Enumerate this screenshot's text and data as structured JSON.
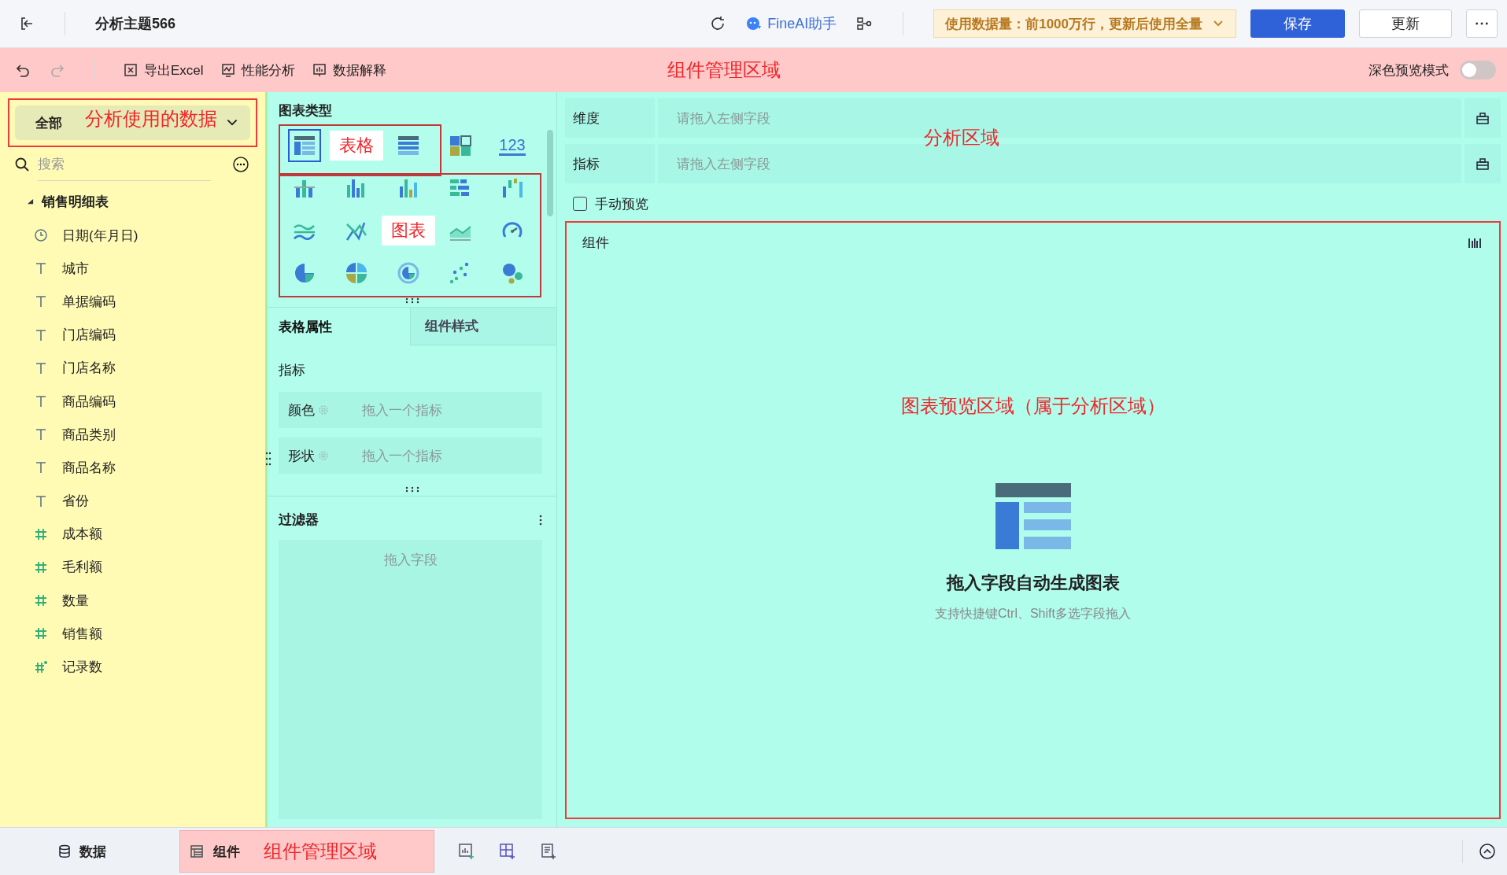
{
  "header": {
    "title": "分析主题566",
    "assistant": "FineAI助手",
    "data_notice": "使用数据量：前1000万行，更新后使用全量",
    "save": "保存",
    "update": "更新"
  },
  "toolbar": {
    "items": [
      {
        "kind": "excel",
        "label": "导出Excel"
      },
      {
        "kind": "performance",
        "label": "性能分析"
      },
      {
        "kind": "explain",
        "label": "数据解释"
      }
    ],
    "annotation": "组件管理区域",
    "dark_mode": {
      "label": "深色预览模式",
      "on": false
    }
  },
  "data_panel": {
    "source": "全部",
    "annotation": "分析使用的数据",
    "search": {
      "placeholder": "搜索"
    },
    "tree": [
      {
        "label": "销售明细表",
        "expanded": true,
        "children": [
          {
            "label": "日期(年月日)",
            "kind": "date"
          },
          {
            "label": "城市",
            "kind": "text"
          },
          {
            "label": "单据编码",
            "kind": "text"
          },
          {
            "label": "门店编码",
            "kind": "text"
          },
          {
            "label": "门店名称",
            "kind": "text"
          },
          {
            "label": "商品编码",
            "kind": "text"
          },
          {
            "label": "商品类别",
            "kind": "text"
          },
          {
            "label": "商品名称",
            "kind": "text"
          },
          {
            "label": "省份",
            "kind": "text"
          },
          {
            "label": "成本额",
            "kind": "number"
          },
          {
            "label": "毛利额",
            "kind": "number"
          },
          {
            "label": "数量",
            "kind": "number"
          },
          {
            "label": "销售额",
            "kind": "number"
          },
          {
            "label": "记录数",
            "kind": "count"
          }
        ]
      }
    ]
  },
  "chart_types": {
    "title": "图表类型",
    "cells": [
      {
        "kind": "table",
        "selected": true
      },
      {
        "kind": "label",
        "text": "表格"
      },
      {
        "kind": "cross_table",
        "selected": false
      },
      {
        "kind": "dashboard",
        "selected": false
      },
      {
        "kind": "number",
        "text": "123",
        "selected": false
      },
      {
        "kind": "stacked_bar",
        "selected": false
      },
      {
        "kind": "grouped_bar",
        "selected": false
      },
      {
        "kind": "bar",
        "selected": false
      },
      {
        "kind": "range_bar",
        "selected": false
      },
      {
        "kind": "waterfall",
        "selected": false
      },
      {
        "kind": "multi_line",
        "selected": false
      },
      {
        "kind": "cross_line",
        "selected": false
      },
      {
        "kind": "label",
        "text": "图表"
      },
      {
        "kind": "area",
        "selected": false
      },
      {
        "kind": "gauge",
        "selected": false
      },
      {
        "kind": "pie",
        "selected": false
      },
      {
        "kind": "multi_pie",
        "selected": false
      },
      {
        "kind": "ring",
        "selected": false
      },
      {
        "kind": "scatter",
        "selected": false
      },
      {
        "kind": "bubble",
        "selected": false
      }
    ]
  },
  "properties": {
    "tabs": [
      {
        "label": "表格属性",
        "selected": true
      },
      {
        "label": "组件样式",
        "selected": false
      }
    ],
    "section": "指标",
    "slots": [
      {
        "label": "颜色",
        "placeholder": "拖入一个指标"
      },
      {
        "label": "形状",
        "placeholder": "拖入一个指标"
      }
    ]
  },
  "filter": {
    "title": "过滤器",
    "placeholder": "拖入字段"
  },
  "analysis": {
    "annotation": "分析区域",
    "shelves": [
      {
        "label": "维度",
        "placeholder": "请拖入左侧字段"
      },
      {
        "label": "指标",
        "placeholder": "请拖入左侧字段"
      }
    ],
    "manual_preview": {
      "label": "手动预览",
      "checked": false
    }
  },
  "preview": {
    "title": "组件",
    "annotation": "图表预览区域（属于分析区域）",
    "empty_title": "拖入字段自动生成图表",
    "empty_hint": "支持快捷键Ctrl、Shift多选字段拖入"
  },
  "bottom_bar": {
    "tabs": [
      {
        "label": "数据",
        "kind": "data",
        "selected": false
      },
      {
        "label": "组件",
        "kind": "component",
        "selected": true
      }
    ],
    "annotation": "组件管理区域"
  }
}
